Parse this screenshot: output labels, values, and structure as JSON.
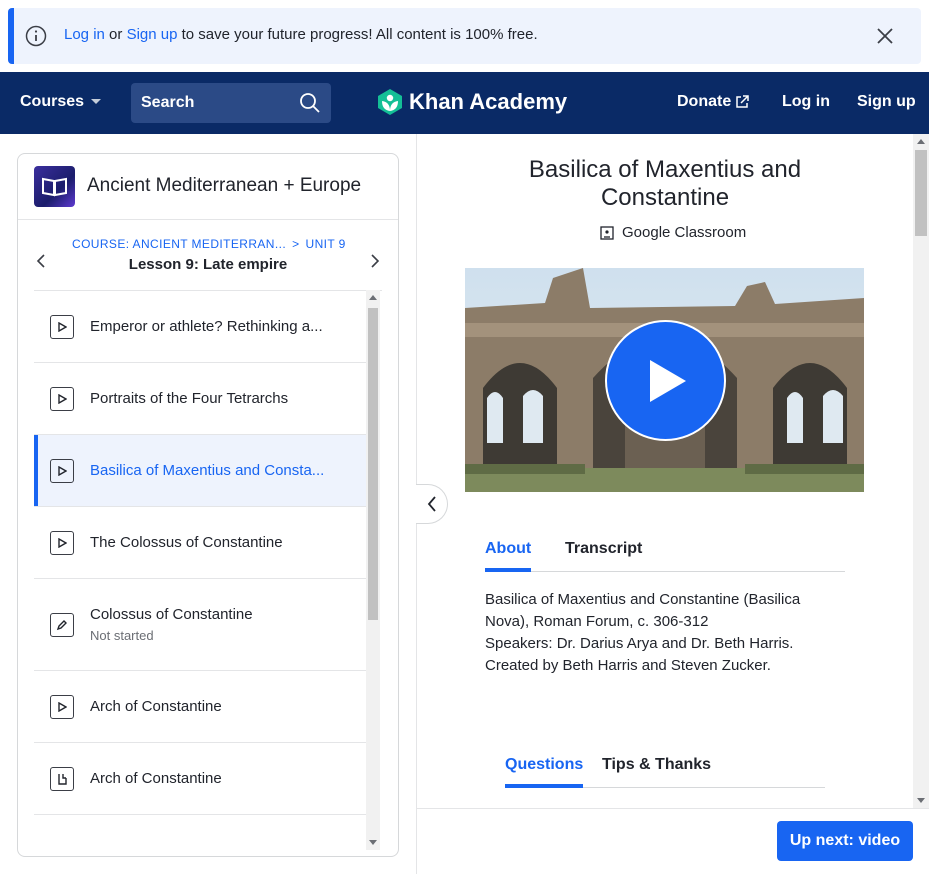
{
  "banner": {
    "login_link": "Log in",
    "or_text": " or ",
    "signup_link": "Sign up",
    "message": " to save your future progress! All content is 100% free."
  },
  "nav": {
    "courses": "Courses",
    "search_placeholder": "Search",
    "logo": "Khan Academy",
    "donate": "Donate",
    "login": "Log in",
    "signup": "Sign up"
  },
  "sidebar": {
    "course_title": "Ancient Mediterranean + Europe",
    "breadcrumb_course": "COURSE: ANCIENT MEDITERRAN...",
    "breadcrumb_sep": ">",
    "breadcrumb_unit": "UNIT 9",
    "lesson": "Lesson 9: Late empire",
    "items": [
      {
        "title": "Emperor or athlete? Rethinking a...",
        "type": "video",
        "subtitle": ""
      },
      {
        "title": "Portraits of the Four Tetrarchs",
        "type": "video",
        "subtitle": ""
      },
      {
        "title": "Basilica of Maxentius and Consta...",
        "type": "video",
        "subtitle": "",
        "selected": true
      },
      {
        "title": "The Colossus of Constantine",
        "type": "video",
        "subtitle": ""
      },
      {
        "title": "Colossus of Constantine",
        "type": "exercise",
        "subtitle": "Not started"
      },
      {
        "title": "Arch of Constantine",
        "type": "video",
        "subtitle": ""
      },
      {
        "title": "Arch of Constantine",
        "type": "article",
        "subtitle": ""
      }
    ]
  },
  "main": {
    "title": "Basilica of Maxentius and Constantine",
    "classroom": "Google Classroom",
    "tabs": [
      {
        "label": "About",
        "active": true
      },
      {
        "label": "Transcript",
        "active": false
      }
    ],
    "about_lines": [
      "Basilica of Maxentius and Constantine (Basilica",
      "Nova), Roman Forum, c. 306-312",
      "Speakers: Dr. Darius Arya and Dr. Beth Harris.",
      "Created by Beth Harris and Steven Zucker."
    ],
    "tabs2": [
      {
        "label": "Questions",
        "active": true
      },
      {
        "label": "Tips & Thanks",
        "active": false
      }
    ],
    "up_next": "Up next: video"
  },
  "colors": {
    "brand_blue": "#1865f2",
    "nav_bg": "#0a2a66",
    "logo_green": "#14bf96"
  }
}
